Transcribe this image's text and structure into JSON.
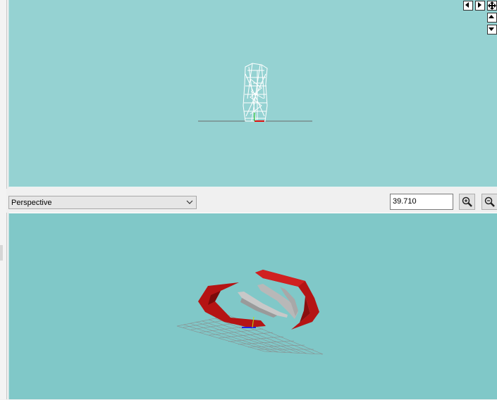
{
  "toolbar": {
    "view_mode": "Perspective",
    "zoom_value": "39.710"
  },
  "icons": {
    "nav_left": "triangle-left-icon",
    "nav_right": "triangle-right-icon",
    "nav_pan": "four-arrows-icon",
    "nav_up": "triangle-up-icon",
    "nav_down": "triangle-down-icon",
    "zoom_in": "magnifier-plus-icon",
    "zoom_out": "magnifier-minus-icon"
  },
  "colors": {
    "top_viewport_bg": "#95d2d2",
    "bottom_viewport_bg": "#80c8c8",
    "model_red": "#b51414",
    "model_grey": "#c8c8c8",
    "wireframe": "#ffffff"
  }
}
